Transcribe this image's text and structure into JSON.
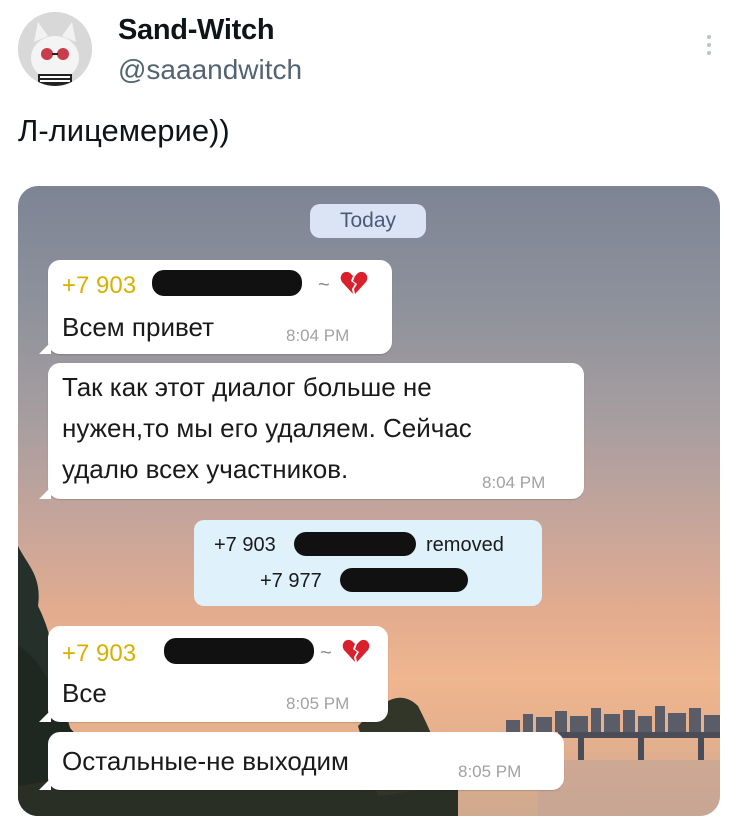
{
  "tweet": {
    "author_name": "Sand-Witch",
    "author_handle": "@saaandwitch",
    "text": "Л-лицемерие))"
  },
  "chat": {
    "date_badge": "Today",
    "messages": [
      {
        "sender_prefix": "+7 903",
        "text": "Всем привет",
        "time": "8:04 PM",
        "sender_icon": "broken-heart-icon"
      },
      {
        "text_lines": [
          "Так как этот диалог больше не",
          "нужен,то мы его удаляем. Сейчас",
          "удалю всех участников."
        ],
        "time": "8:04 PM"
      },
      {
        "sender_prefix": "+7 903",
        "text": "Все",
        "time": "8:05 PM",
        "sender_icon": "broken-heart-icon"
      },
      {
        "text": "Остальные-не выходим",
        "time": "8:05 PM"
      }
    ],
    "system_message": {
      "actor_prefix": "+7 903",
      "action": "removed",
      "target_prefix": "+7 977"
    }
  },
  "colors": {
    "sender_name": "#d9b000",
    "system_bg": "#dff1fb",
    "date_badge_bg": "#dbe4f4"
  }
}
